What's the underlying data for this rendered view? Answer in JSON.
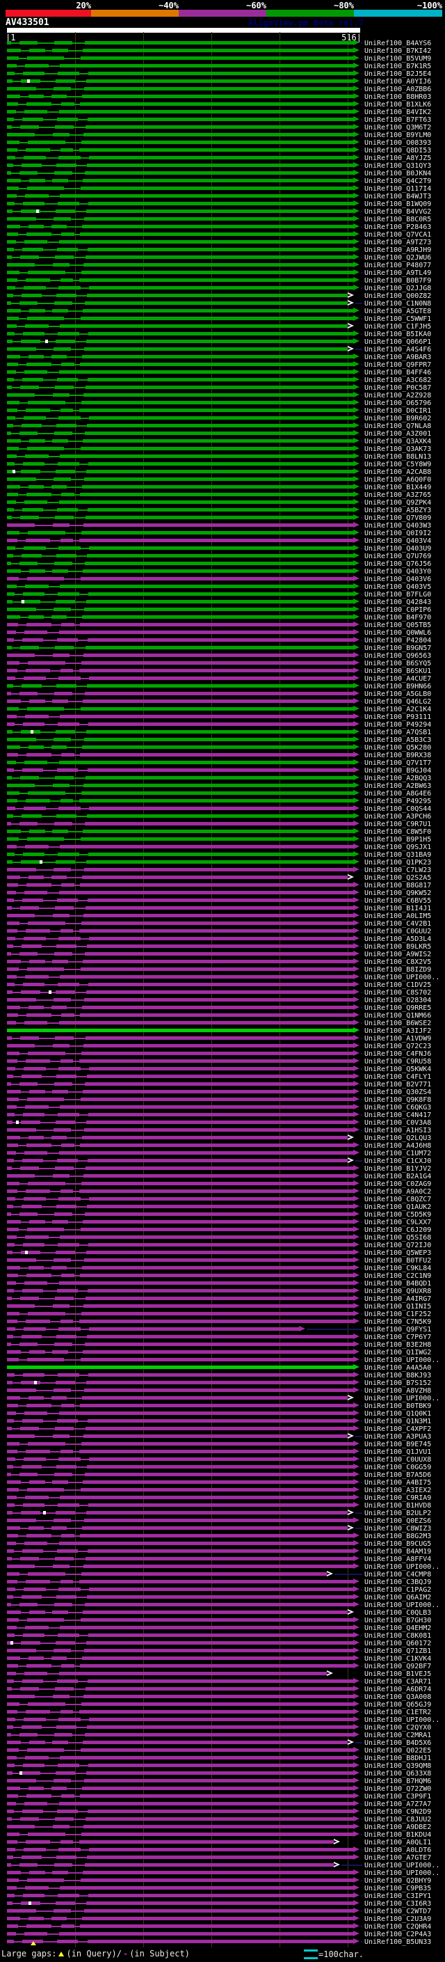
{
  "header": {
    "watermark": "AlignView.pm Beta rel.7",
    "ruler_start_text": "|1",
    "ruler_end_text": "516|"
  },
  "legend": {
    "large_gaps": "Large gaps:",
    "query_text": "(in Query)/",
    "subject_dash": "-",
    "subject_text": "(in Subject)",
    "scale_text": "=100char."
  },
  "colors": {
    "bar_green": "#00a400",
    "bar_purple": "#a22ca2",
    "bar_bright_green": "#00d000",
    "connector_navy": "#14145a",
    "grid_olive": "#3a3a12",
    "query_bar": "#ffffff",
    "gap_marker_yellow": "#ffff33",
    "scale_icon_cyan": "#00cccc"
  },
  "chart_data": {
    "type": "bar",
    "title": "AV433501",
    "xlabel": "",
    "ylabel": "",
    "x_range": [
      1,
      516
    ],
    "grid": true,
    "legend_position": "top",
    "identity_key": [
      {
        "label": "20%",
        "color": "#ee1122"
      },
      {
        "label": "~40%",
        "color": "#dd7700"
      },
      {
        "label": "~60%",
        "color": "#9b2d9b"
      },
      {
        "label": "~80%",
        "color": "#009903"
      },
      {
        "label": "~100%",
        "color": "#00b4c8"
      }
    ],
    "color_code_meaning": {
      "g": "~80% identity (green)",
      "p": "~60% identity (purple)",
      "G": "bright green full-length hit"
    },
    "hits": [
      [
        "UniRef100_B4AYS6",
        "g"
      ],
      [
        "UniRef100_B7KI42",
        "g"
      ],
      [
        "UniRef100_B5VUM9",
        "g"
      ],
      [
        "UniRef100_B7K1R5",
        "g"
      ],
      [
        "UniRef100_B2J5E4",
        "g"
      ],
      [
        "UniRef100_A0YIJ6",
        "g"
      ],
      [
        "UniRef100_A0ZBB6",
        "g"
      ],
      [
        "UniRef100_B8HR03",
        "g"
      ],
      [
        "UniRef100_B1XLK6",
        "g"
      ],
      [
        "UniRef100_B4VIK2",
        "g"
      ],
      [
        "UniRef100_B7FT63",
        "g"
      ],
      [
        "UniRef100_Q3M6T2",
        "g"
      ],
      [
        "UniRef100_B9YLM0",
        "g"
      ],
      [
        "UniRef100_O08393",
        "g"
      ],
      [
        "UniRef100_Q8DI53",
        "g"
      ],
      [
        "UniRef100_A8YJZ5",
        "g"
      ],
      [
        "UniRef100_Q31QY3",
        "g"
      ],
      [
        "UniRef100_B0JKN4",
        "g"
      ],
      [
        "UniRef100_Q4C2T9",
        "g"
      ],
      [
        "UniRef100_Q117I4",
        "g"
      ],
      [
        "UniRef100_B4WJT3",
        "g"
      ],
      [
        "UniRef100_B1WQ09",
        "g"
      ],
      [
        "UniRef100_B4VVG2",
        "g"
      ],
      [
        "UniRef100_B8C0R5",
        "g"
      ],
      [
        "UniRef100_P28463",
        "g"
      ],
      [
        "UniRef100_Q7VCA1",
        "g"
      ],
      [
        "UniRef100_A9TZ73",
        "g"
      ],
      [
        "UniRef100_A9RJH9",
        "g"
      ],
      [
        "UniRef100_Q2JWU6",
        "g"
      ],
      [
        "UniRef100_P48077",
        "g"
      ],
      [
        "UniRef100_A9TL49",
        "g"
      ],
      [
        "UniRef100_B0B7F9",
        "g"
      ],
      [
        "UniRef100_Q2JJG8",
        "g"
      ],
      [
        "UniRef100_Q00Z82",
        "g",
        "o"
      ],
      [
        "UniRef100_C1N0N8",
        "g",
        "o"
      ],
      [
        "UniRef100_A5GTE8",
        "g"
      ],
      [
        "UniRef100_C5WWF1",
        "g"
      ],
      [
        "UniRef100_C1FJH5",
        "g",
        "o"
      ],
      [
        "UniRef100_B5IKA0",
        "g"
      ],
      [
        "UniRef100_Q066P1",
        "g"
      ],
      [
        "UniRef100_A4S4F6",
        "g",
        "o"
      ],
      [
        "UniRef100_A9BAR3",
        "g"
      ],
      [
        "UniRef100_Q9FPR7",
        "g"
      ],
      [
        "UniRef100_B4FF46",
        "g"
      ],
      [
        "UniRef100_A3C682",
        "g"
      ],
      [
        "UniRef100_P0C587",
        "g"
      ],
      [
        "UniRef100_A2Z928",
        "g"
      ],
      [
        "UniRef100_O65796",
        "g"
      ],
      [
        "UniRef100_D0CIR1",
        "g"
      ],
      [
        "UniRef100_B9R602",
        "g"
      ],
      [
        "UniRef100_Q7NLA8",
        "g"
      ],
      [
        "UniRef100_A3Z001",
        "g"
      ],
      [
        "UniRef100_Q3AXK4",
        "g"
      ],
      [
        "UniRef100_Q3AK73",
        "g"
      ],
      [
        "UniRef100_B8LN13",
        "g"
      ],
      [
        "UniRef100_C5Y8W9",
        "g"
      ],
      [
        "UniRef100_A2CAB8",
        "g"
      ],
      [
        "UniRef100_A6Q0F0",
        "g"
      ],
      [
        "UniRef100_B1X449",
        "g"
      ],
      [
        "UniRef100_A3Z765",
        "g"
      ],
      [
        "UniRef100_Q9ZPK4",
        "g"
      ],
      [
        "UniRef100_A5BZY3",
        "g"
      ],
      [
        "UniRef100_Q7V809",
        "g"
      ],
      [
        "UniRef100_Q403W3",
        "p"
      ],
      [
        "UniRef100_Q0I9I2",
        "g"
      ],
      [
        "UniRef100_Q403V4",
        "p"
      ],
      [
        "UniRef100_Q403U9",
        "g"
      ],
      [
        "UniRef100_Q7U769",
        "g"
      ],
      [
        "UniRef100_Q76J56",
        "g"
      ],
      [
        "UniRef100_Q403Y0",
        "g"
      ],
      [
        "UniRef100_Q403V6",
        "p"
      ],
      [
        "UniRef100_Q403V5",
        "g"
      ],
      [
        "UniRef100_B7FLG0",
        "g"
      ],
      [
        "UniRef100_Q42843",
        "g"
      ],
      [
        "UniRef100_C0PIP6",
        "g"
      ],
      [
        "UniRef100_B4F970",
        "g"
      ],
      [
        "UniRef100_Q05TB5",
        "p"
      ],
      [
        "UniRef100_Q0WWL6",
        "p"
      ],
      [
        "UniRef100_P42804",
        "p"
      ],
      [
        "UniRef100_B9GN57",
        "g"
      ],
      [
        "UniRef100_Q96563",
        "p"
      ],
      [
        "UniRef100_B6SYQ5",
        "p"
      ],
      [
        "UniRef100_B6SKU1",
        "p"
      ],
      [
        "UniRef100_A4CUE7",
        "p"
      ],
      [
        "UniRef100_B9HN66",
        "g"
      ],
      [
        "UniRef100_A5GLB0",
        "p"
      ],
      [
        "UniRef100_Q46LG2",
        "p"
      ],
      [
        "UniRef100_A2C1K4",
        "g"
      ],
      [
        "UniRef100_P93111",
        "p"
      ],
      [
        "UniRef100_P49294",
        "p"
      ],
      [
        "UniRef100_A7QSB1",
        "g"
      ],
      [
        "UniRef100_A5B3C3",
        "g"
      ],
      [
        "UniRef100_Q5K280",
        "g"
      ],
      [
        "UniRef100_B9RX38",
        "p"
      ],
      [
        "UniRef100_Q7V1T7",
        "g"
      ],
      [
        "UniRef100_B9GJ04",
        "p"
      ],
      [
        "UniRef100_A2BQQ3",
        "g"
      ],
      [
        "UniRef100_A2BW63",
        "g"
      ],
      [
        "UniRef100_A8G4E6",
        "g"
      ],
      [
        "UniRef100_P49295",
        "g"
      ],
      [
        "UniRef100_C0QS44",
        "p"
      ],
      [
        "UniRef100_A3PCH6",
        "g"
      ],
      [
        "UniRef100_C9R7U1",
        "p"
      ],
      [
        "UniRef100_C8W5F0",
        "g"
      ],
      [
        "UniRef100_B9P1H5",
        "g"
      ],
      [
        "UniRef100_Q9SJX1",
        "p"
      ],
      [
        "UniRef100_Q31BA9",
        "g"
      ],
      [
        "UniRef100_Q1PK23",
        "g"
      ],
      [
        "UniRef100_C7LW23",
        "p"
      ],
      [
        "UniRef100_Q2S2A5",
        "p",
        "o"
      ],
      [
        "UniRef100_B8G817",
        "p"
      ],
      [
        "UniRef100_Q9KW52",
        "p"
      ],
      [
        "UniRef100_C6BV55",
        "p"
      ],
      [
        "UniRef100_B1I4J1",
        "p"
      ],
      [
        "UniRef100_A0LIM5",
        "p"
      ],
      [
        "UniRef100_C4V2B1",
        "p"
      ],
      [
        "UniRef100_C0GUU2",
        "p"
      ],
      [
        "UniRef100_A5D3L4",
        "p"
      ],
      [
        "UniRef100_B9LKR5",
        "p"
      ],
      [
        "UniRef100_A9WIS2",
        "p"
      ],
      [
        "UniRef100_C8X2V5",
        "p"
      ],
      [
        "UniRef100_B8IZD9",
        "p"
      ],
      [
        "UniRef100_UPI000..",
        "p"
      ],
      [
        "UniRef100_C1DV25",
        "p"
      ],
      [
        "UniRef100_C8S702",
        "p"
      ],
      [
        "UniRef100_O28304",
        "p"
      ],
      [
        "UniRef100_Q9RRE5",
        "p"
      ],
      [
        "UniRef100_Q1NM66",
        "p"
      ],
      [
        "UniRef100_B6WSE2",
        "p"
      ],
      [
        "UniRef100_A3IJF2",
        "G"
      ],
      [
        "UniRef100_A1VDW9",
        "p"
      ],
      [
        "UniRef100_Q72C23",
        "p"
      ],
      [
        "UniRef100_C4FNJ6",
        "p"
      ],
      [
        "UniRef100_C9RU58",
        "p"
      ],
      [
        "UniRef100_Q5KWK4",
        "p"
      ],
      [
        "UniRef100_C4FLY1",
        "p"
      ],
      [
        "UniRef100_B2V771",
        "p"
      ],
      [
        "UniRef100_Q30ZS4",
        "p"
      ],
      [
        "UniRef100_Q9K8F8",
        "p"
      ],
      [
        "UniRef100_C6QKG3",
        "p"
      ],
      [
        "UniRef100_C4N417",
        "p"
      ],
      [
        "UniRef100_C0V3A8",
        "p"
      ],
      [
        "UniRef100_A1HSI3",
        "p"
      ],
      [
        "UniRef100_Q2LQU3",
        "p",
        "o"
      ],
      [
        "UniRef100_A4J6H8",
        "p"
      ],
      [
        "UniRef100_C1UM72",
        "p"
      ],
      [
        "UniRef100_C1CXJ0",
        "p",
        "o"
      ],
      [
        "UniRef100_B1YJV2",
        "p"
      ],
      [
        "UniRef100_B2A1G4",
        "p"
      ],
      [
        "UniRef100_C0ZAG9",
        "p"
      ],
      [
        "UniRef100_A9A0C2",
        "p"
      ],
      [
        "UniRef100_C8QZC7",
        "p"
      ],
      [
        "UniRef100_Q1AUK2",
        "p"
      ],
      [
        "UniRef100_C5D5K9",
        "p"
      ],
      [
        "UniRef100_C9LXX7",
        "p"
      ],
      [
        "UniRef100_C6J209",
        "p"
      ],
      [
        "UniRef100_Q5SI68",
        "p"
      ],
      [
        "UniRef100_Q72IJ0",
        "p"
      ],
      [
        "UniRef100_Q5WEP3",
        "p"
      ],
      [
        "UniRef100_B0TFU2",
        "p"
      ],
      [
        "UniRef100_C9KL84",
        "p"
      ],
      [
        "UniRef100_C2C1N9",
        "p"
      ],
      [
        "UniRef100_B4BQD1",
        "p"
      ],
      [
        "UniRef100_Q9UXR8",
        "p"
      ],
      [
        "UniRef100_A4IRG7",
        "p"
      ],
      [
        "UniRef100_Q1INI5",
        "p"
      ],
      [
        "UniRef100_C1F252",
        "p"
      ],
      [
        "UniRef100_C7N5K9",
        "p"
      ],
      [
        "UniRef100_Q9FYS1",
        "p",
        "s",
        430
      ],
      [
        "UniRef100_C7P6Y7",
        "p"
      ],
      [
        "UniRef100_B3E2H8",
        "p"
      ],
      [
        "UniRef100_Q1IWG2",
        "p"
      ],
      [
        "UniRef100_UPI000..",
        "p"
      ],
      [
        "UniRef100_A4A5A0",
        "G"
      ],
      [
        "UniRef100_B8KJ93",
        "p"
      ],
      [
        "UniRef100_B7S152",
        "p"
      ],
      [
        "UniRef100_A8VZH8",
        "p"
      ],
      [
        "UniRef100_UPI000..",
        "p",
        "o"
      ],
      [
        "UniRef100_B0TBK9",
        "p"
      ],
      [
        "UniRef100_Q1Q0K1",
        "p"
      ],
      [
        "UniRef100_Q1N3M1",
        "p"
      ],
      [
        "UniRef100_C4XPF2",
        "p"
      ],
      [
        "UniRef100_A3PUA3",
        "p",
        "o"
      ],
      [
        "UniRef100_B9E745",
        "p"
      ],
      [
        "UniRef100_Q1JVU1",
        "p"
      ],
      [
        "UniRef100_C0UUX8",
        "p"
      ],
      [
        "UniRef100_C0GG59",
        "p"
      ],
      [
        "UniRef100_B7A5D6",
        "p"
      ],
      [
        "UniRef100_A4BI75",
        "p"
      ],
      [
        "UniRef100_A3IEX2",
        "p"
      ],
      [
        "UniRef100_C9RIA9",
        "p"
      ],
      [
        "UniRef100_B1HVD8",
        "p"
      ],
      [
        "UniRef100_B2ULP2",
        "p",
        "o"
      ],
      [
        "UniRef100_Q0EZS6",
        "p"
      ],
      [
        "UniRef100_C8WIZ3",
        "p",
        "o"
      ],
      [
        "UniRef100_B8G2M3",
        "p"
      ],
      [
        "UniRef100_B9CUG5",
        "p"
      ],
      [
        "UniRef100_B4AM19",
        "p"
      ],
      [
        "UniRef100_A8FFV4",
        "p"
      ],
      [
        "UniRef100_UPI000..",
        "p"
      ],
      [
        "UniRef100_C4CMP8",
        "p",
        "o",
        470
      ],
      [
        "UniRef100_C3BQJ9",
        "p"
      ],
      [
        "UniRef100_C1PAG2",
        "p"
      ],
      [
        "UniRef100_Q6AIM2",
        "p"
      ],
      [
        "UniRef100_UPI000..",
        "p"
      ],
      [
        "UniRef100_C0QLB3",
        "p",
        "o"
      ],
      [
        "UniRef100_B7GH30",
        "p"
      ],
      [
        "UniRef100_Q4EHM2",
        "p"
      ],
      [
        "UniRef100_C8K081",
        "p"
      ],
      [
        "UniRef100_Q60172",
        "p"
      ],
      [
        "UniRef100_Q71ZB1",
        "p"
      ],
      [
        "UniRef100_C1KVK4",
        "p"
      ],
      [
        "UniRef100_Q92BF7",
        "p"
      ],
      [
        "UniRef100_B1VEJ5",
        "p",
        "o",
        470
      ],
      [
        "UniRef100_C3AR71",
        "p"
      ],
      [
        "UniRef100_A6DR74",
        "p"
      ],
      [
        "UniRef100_Q3A008",
        "p"
      ],
      [
        "UniRef100_Q65GJ9",
        "p"
      ],
      [
        "UniRef100_C1ETR2",
        "p"
      ],
      [
        "UniRef100_UPI000..",
        "p"
      ],
      [
        "UniRef100_C2QYX0",
        "p"
      ],
      [
        "UniRef100_C2MRA1",
        "p"
      ],
      [
        "UniRef100_B4D5X6",
        "p",
        "o"
      ],
      [
        "UniRef100_Q022E5",
        "p"
      ],
      [
        "UniRef100_B8DHJ1",
        "p"
      ],
      [
        "UniRef100_Q39QM8",
        "p"
      ],
      [
        "UniRef100_Q633X8",
        "p"
      ],
      [
        "UniRef100_B7HQM6",
        "p"
      ],
      [
        "UniRef100_Q72ZW0",
        "p"
      ],
      [
        "UniRef100_C3P9F1",
        "p"
      ],
      [
        "UniRef100_A7Z7A7",
        "p"
      ],
      [
        "UniRef100_C9N2D9",
        "p"
      ],
      [
        "UniRef100_C8JUU2",
        "p"
      ],
      [
        "UniRef100_A9DBE2",
        "p"
      ],
      [
        "UniRef100_B1KDU4",
        "p"
      ],
      [
        "UniRef100_A0QLI1",
        "p",
        "o",
        480
      ],
      [
        "UniRef100_A0LDT6",
        "p"
      ],
      [
        "UniRef100_A7GTE7",
        "p"
      ],
      [
        "UniRef100_UPI000..",
        "p",
        "o",
        480
      ],
      [
        "UniRef100_UPI000..",
        "p"
      ],
      [
        "UniRef100_Q2BHY9",
        "p"
      ],
      [
        "UniRef100_C9PB35",
        "p"
      ],
      [
        "UniRef100_C3IPY1",
        "p"
      ],
      [
        "UniRef100_C3I6R3",
        "p"
      ],
      [
        "UniRef100_C2WTD7",
        "p"
      ],
      [
        "UniRef100_C2U3A9",
        "p"
      ],
      [
        "UniRef100_C2QHR4",
        "p"
      ],
      [
        "UniRef100_C2P4A3",
        "p"
      ],
      [
        "UniRef100_B5UN33",
        "p"
      ]
    ]
  }
}
